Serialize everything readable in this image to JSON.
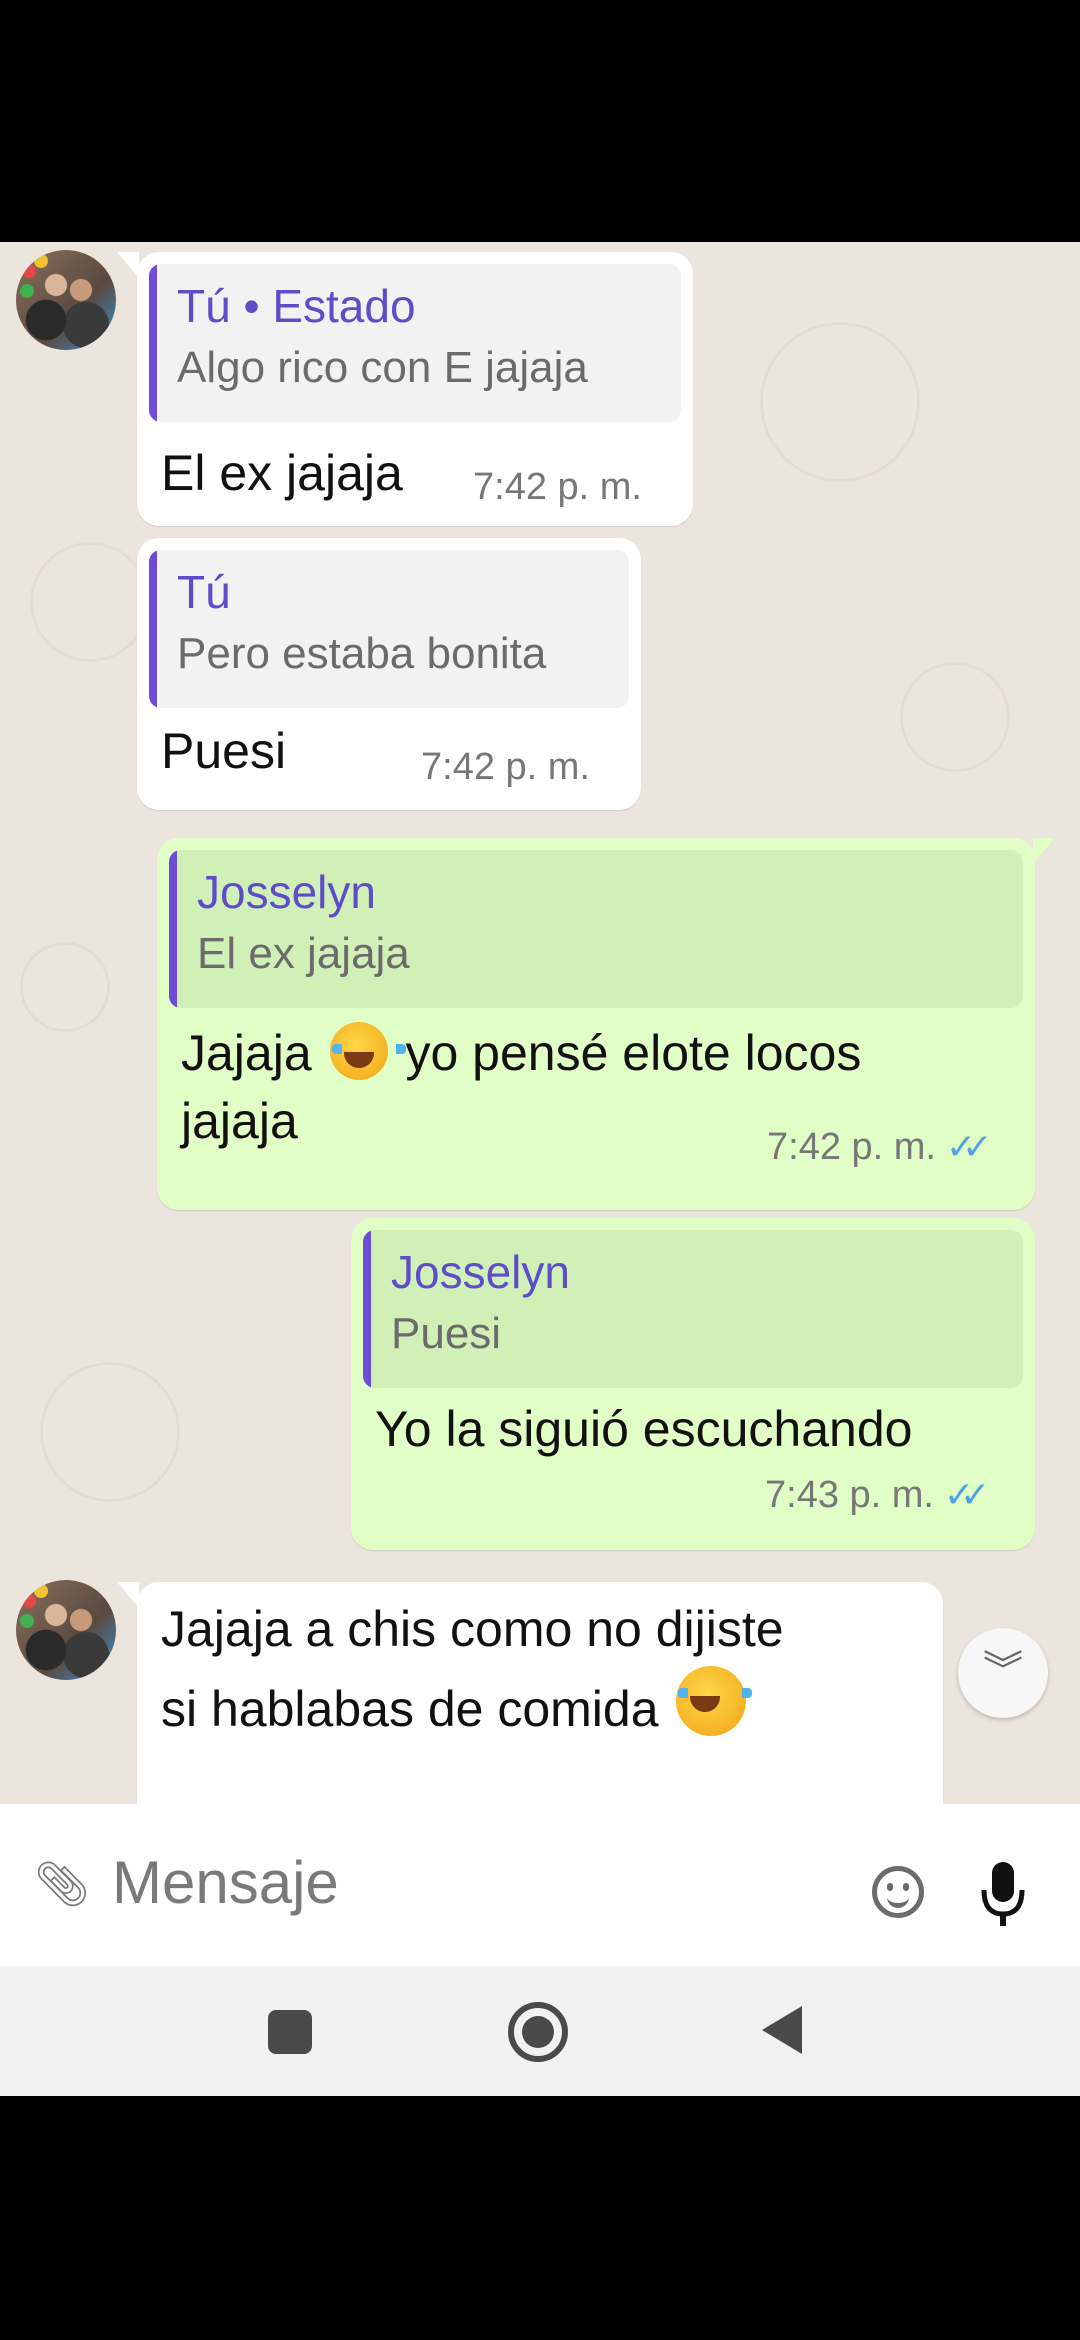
{
  "messages": [
    {
      "direction": "incoming",
      "quote": {
        "author": "Tú • Estado",
        "text": "Algo rico con E jajaja"
      },
      "text": "El ex jajaja",
      "time": "7:42 p. m."
    },
    {
      "direction": "incoming",
      "quote": {
        "author": "Tú",
        "text": "Pero estaba bonita"
      },
      "text": "Puesi",
      "time": "7:42 p. m."
    },
    {
      "direction": "outgoing",
      "quote": {
        "author": "Josselyn",
        "text": "El ex jajaja"
      },
      "text_before_emoji": "Jajaja",
      "emoji": "face-with-tears-of-joy",
      "text_after_emoji": "yo pensé elote locos",
      "text_line2": "jajaja",
      "time": "7:42 p. m.",
      "status": "read"
    },
    {
      "direction": "outgoing",
      "quote": {
        "author": "Josselyn",
        "text": "Puesi"
      },
      "text": "Yo la siguió escuchando",
      "time": "7:43 p. m.",
      "status": "read"
    },
    {
      "direction": "incoming",
      "text_line1": "Jajaja a chis como no dijiste",
      "text_line2": "si hablabas de comida",
      "emoji": "rolling-on-the-floor-laughing"
    }
  ],
  "input": {
    "placeholder": "Mensaje"
  },
  "icons": {
    "attach": "paperclip-icon",
    "emoji": "smiley-icon",
    "mic": "microphone-icon",
    "scroll": "double-chevron-down-icon"
  },
  "colors": {
    "incoming_bubble": "#ffffff",
    "outgoing_bubble": "#e1fec6",
    "quote_bar": "#6f4bd8",
    "read_check": "#4fa3e0",
    "chat_background": "#ece5dd"
  }
}
